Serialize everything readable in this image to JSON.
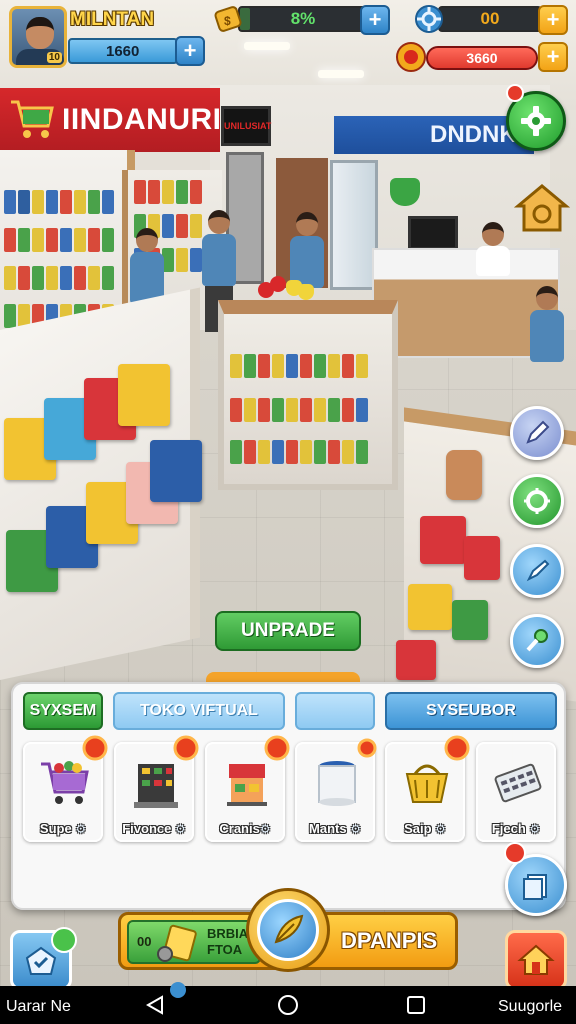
{
  "player": {
    "name": "MILNTAN",
    "level": "10",
    "money": "1660"
  },
  "hud": {
    "progress_value": "8%",
    "progress_fraction": 0.08,
    "gears_value": "00",
    "energy_value": "3660"
  },
  "store": {
    "sign_left": "IINDANURIA",
    "sign_right": "DNDNK",
    "tv_text": "UNILUSIAT"
  },
  "actions": {
    "upgrade_label": "UNPRADE"
  },
  "panel": {
    "tabs": [
      {
        "label": "SYXSEM"
      },
      {
        "label": "TOKO VIFTUAL"
      },
      {
        "label": ""
      },
      {
        "label": "SYSEUBOR"
      }
    ],
    "cards": [
      {
        "label": "Supe",
        "icon": "cart-icon",
        "color": "#3d93d3"
      },
      {
        "label": "Fivonce",
        "icon": "building-icon",
        "color": "#cfe7f7"
      },
      {
        "label": "Cranis",
        "icon": "shop-icon",
        "color": "#cfe7f7"
      },
      {
        "label": "Mants",
        "icon": "jar-icon",
        "color": "#f6c7b8"
      },
      {
        "label": "Saip",
        "icon": "basket-icon",
        "color": "#3d93d3"
      },
      {
        "label": "Fjech",
        "icon": "calculator-icon",
        "color": "#c9b06b"
      }
    ]
  },
  "bottom_bar": {
    "count": "00",
    "text_line1": "BRBIA",
    "text_line2": "FTOA",
    "right_label": "DPANPIS"
  },
  "system_nav": {
    "left_label": "Uarar Ne",
    "right_label": "Suugorle"
  }
}
